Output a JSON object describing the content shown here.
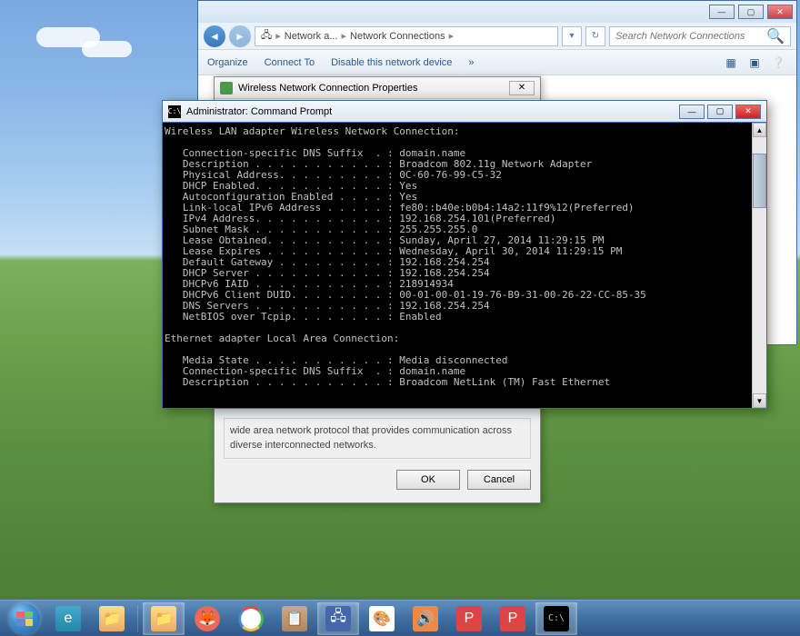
{
  "desktop": {},
  "explorer": {
    "breadcrumb": {
      "part1": "Network a...",
      "part2": "Network Connections"
    },
    "search_placeholder": "Search Network Connections",
    "toolbar": {
      "organize": "Organize",
      "connect_to": "Connect To",
      "disable": "Disable this network device",
      "more": "»"
    }
  },
  "props_dialog": {
    "title": "Wireless Network Connection Properties",
    "description": "wide area network protocol that provides communication across diverse interconnected networks.",
    "ok": "OK",
    "cancel": "Cancel"
  },
  "cmd": {
    "title": "Administrator: Command Prompt",
    "output": "Wireless LAN adapter Wireless Network Connection:\n\n   Connection-specific DNS Suffix  . : domain.name\n   Description . . . . . . . . . . . : Broadcom 802.11g Network Adapter\n   Physical Address. . . . . . . . . : 0C-60-76-99-C5-32\n   DHCP Enabled. . . . . . . . . . . : Yes\n   Autoconfiguration Enabled . . . . : Yes\n   Link-local IPv6 Address . . . . . : fe80::b40e:b0b4:14a2:11f9%12(Preferred)\n   IPv4 Address. . . . . . . . . . . : 192.168.254.101(Preferred)\n   Subnet Mask . . . . . . . . . . . : 255.255.255.0\n   Lease Obtained. . . . . . . . . . : Sunday, April 27, 2014 11:29:15 PM\n   Lease Expires . . . . . . . . . . : Wednesday, April 30, 2014 11:29:15 PM\n   Default Gateway . . . . . . . . . : 192.168.254.254\n   DHCP Server . . . . . . . . . . . : 192.168.254.254\n   DHCPv6 IAID . . . . . . . . . . . : 218914934\n   DHCPv6 Client DUID. . . . . . . . : 00-01-00-01-19-76-B9-31-00-26-22-CC-85-35\n   DNS Servers . . . . . . . . . . . : 192.168.254.254\n   NetBIOS over Tcpip. . . . . . . . : Enabled\n\nEthernet adapter Local Area Connection:\n\n   Media State . . . . . . . . . . . : Media disconnected\n   Connection-specific DNS Suffix  . : domain.name\n   Description . . . . . . . . . . . : Broadcom NetLink (TM) Fast Ethernet"
  },
  "taskbar": {
    "items": [
      "Start",
      "Internet Explorer",
      "File Explorer",
      "Explorer",
      "Firefox",
      "Chrome",
      "App",
      "Network",
      "Paint",
      "Audio",
      "PowerPoint",
      "PowerPoint",
      "Command Prompt"
    ]
  }
}
